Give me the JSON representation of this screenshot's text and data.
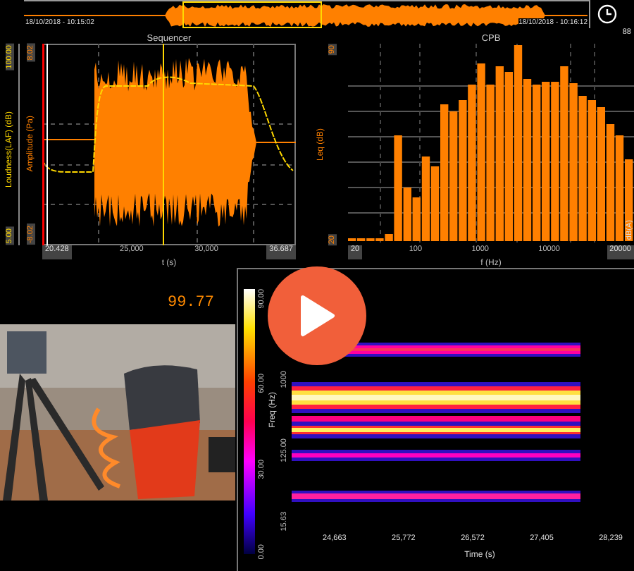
{
  "timeline": {
    "start": "18/10/2018 - 10:15:02",
    "end": "18/10/2018 - 10:16:12"
  },
  "time_chart": {
    "title": "Sequencer",
    "ylabel_left": "Loudness(LAF) (dB)",
    "ylabel_right": "Amplitude (Pa)",
    "y_left_ticks": [
      "100.00",
      "5.00"
    ],
    "y_right_ticks": [
      "8.02",
      "-8.02"
    ],
    "xticks": [
      "20.428",
      "25,000",
      "30,000",
      "36.687"
    ],
    "xlabel": "t (s)"
  },
  "cpb_chart": {
    "title": "CPB",
    "corner": "88",
    "ylabel": "Leq (dB)",
    "yticks": [
      "90",
      "20"
    ],
    "xticks": [
      "20",
      "100",
      "1000",
      "10000",
      "20000"
    ],
    "xlabel": "f (Hz)",
    "right_label": "dB(A)"
  },
  "readout": "99.77",
  "spectrogram": {
    "scale_ticks": [
      "90.00",
      "60.00",
      "30.00",
      "0.00"
    ],
    "ylabel": "Freq (Hz)",
    "yticks": [
      "1000",
      "125.00",
      "15.63"
    ],
    "xticks": [
      "24,663",
      "25,772",
      "26,572",
      "27,405",
      "28,239"
    ],
    "xlabel": "Time (s)"
  }
}
